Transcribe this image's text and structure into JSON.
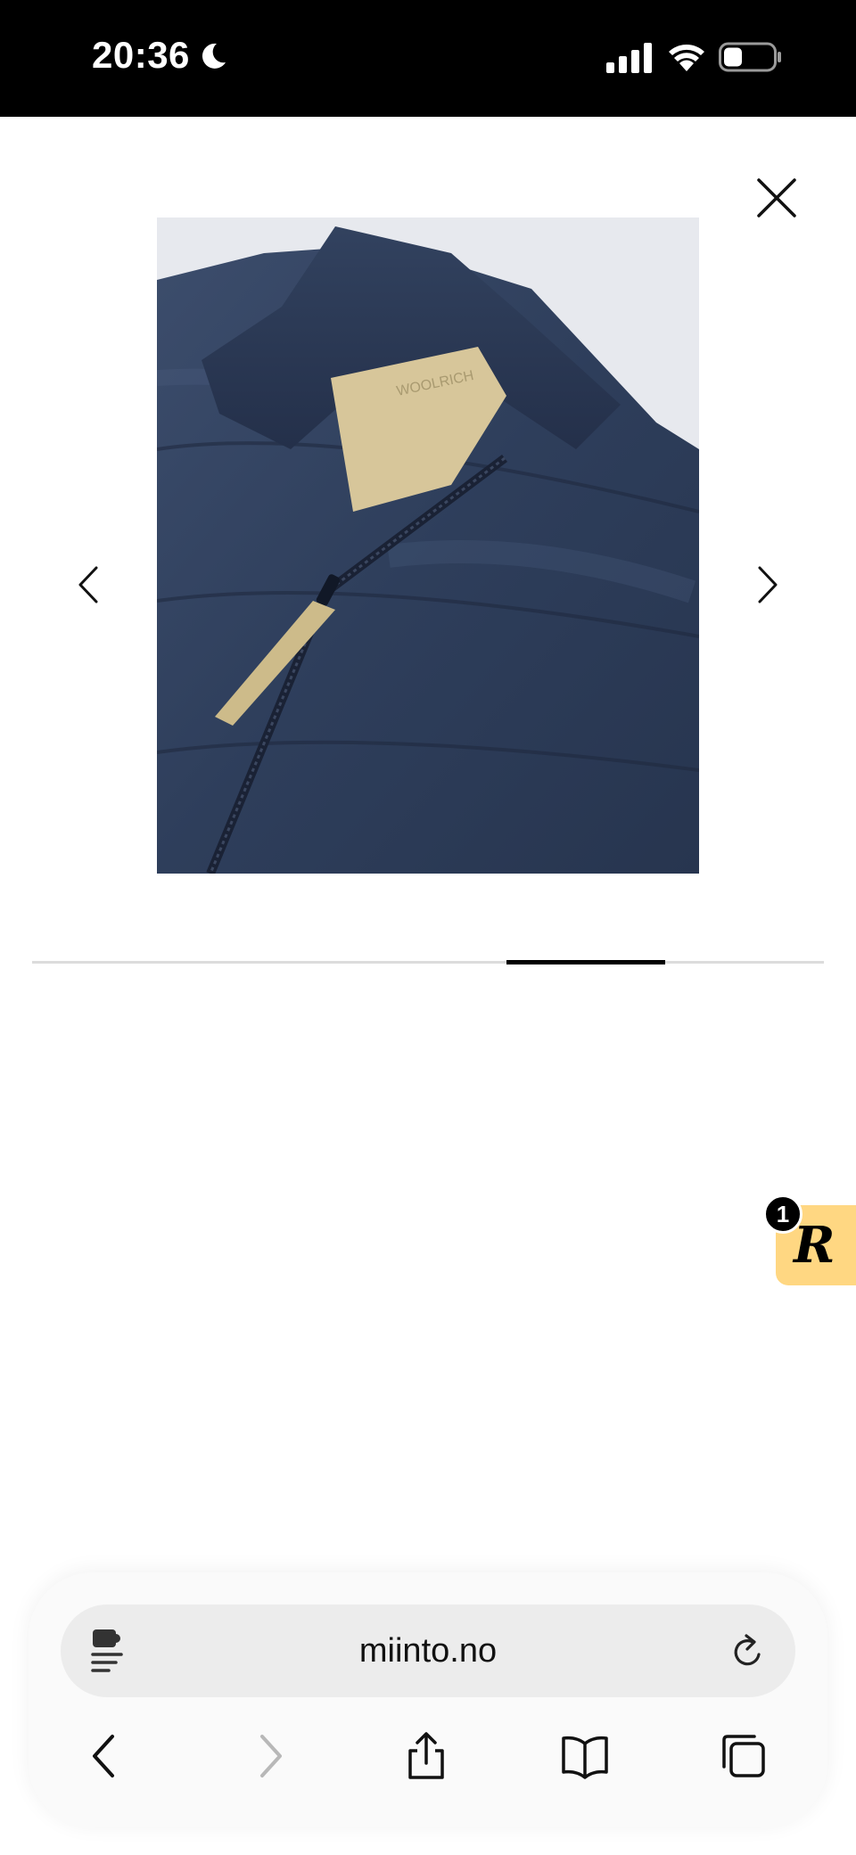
{
  "status_bar": {
    "time": "20:36",
    "icons": [
      "moon-icon",
      "signal-icon",
      "wifi-icon",
      "battery-icon"
    ]
  },
  "gallery": {
    "close_icon": "close-icon",
    "prev_icon": "chevron-left-icon",
    "next_icon": "chevron-right-icon",
    "image_subject": "navy puffer jacket",
    "label_brand": "WOOLRICH",
    "slide_progress": {
      "active_index": 3,
      "total": 5
    }
  },
  "rewards": {
    "badge_count": "1",
    "letter": "R",
    "color": "#ffd782"
  },
  "browser": {
    "url": "miinto.no",
    "toolbar": [
      "back-icon",
      "forward-icon",
      "share-icon",
      "bookmarks-icon",
      "tabs-icon"
    ]
  }
}
